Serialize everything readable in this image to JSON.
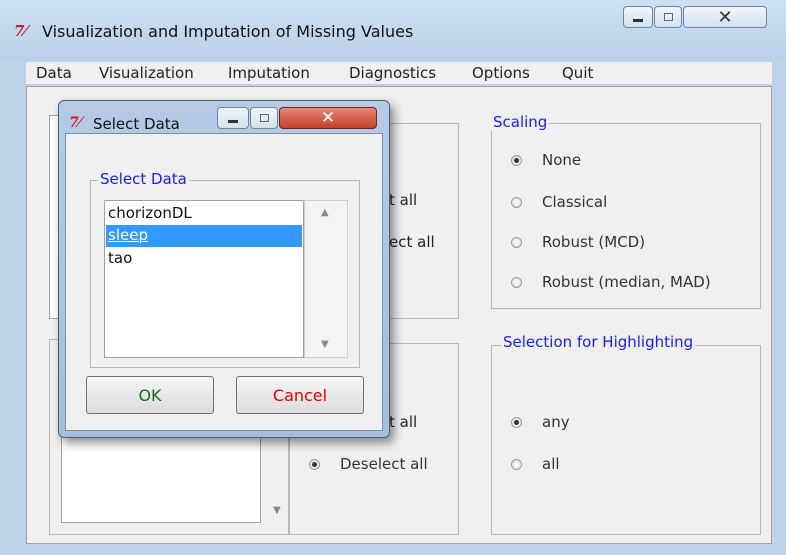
{
  "main_window": {
    "title": "Visualization and Imputation of Missing Values",
    "logo": "7⁄"
  },
  "menu": [
    "Data",
    "Visualization",
    "Imputation",
    "Diagnostics",
    "Options",
    "Quit"
  ],
  "left_panel": {
    "select_all_partial": "t all",
    "deselect_all_partial": "ect all",
    "select_all_partial_2": "t all",
    "deselect_all": "Deselect all"
  },
  "scaling": {
    "title": "Scaling",
    "options": [
      "None",
      "Classical",
      "Robust (MCD)",
      "Robust (median, MAD)"
    ],
    "selected": 0
  },
  "highlighting": {
    "title": "Selection for Highlighting",
    "options": [
      "any",
      "all"
    ],
    "selected": 0
  },
  "dialog": {
    "title": "Select Data",
    "group_title": "Select Data",
    "items": [
      "chorizonDL",
      "sleep",
      "tao"
    ],
    "selected_index": 1,
    "ok_label": "OK",
    "cancel_label": "Cancel"
  },
  "colors": {
    "group_title": "#1a1aff",
    "selection": "#3399ff",
    "ok_text": "#1a6b1a",
    "cancel_text": "#e00000",
    "close_red": "#c53f25"
  }
}
